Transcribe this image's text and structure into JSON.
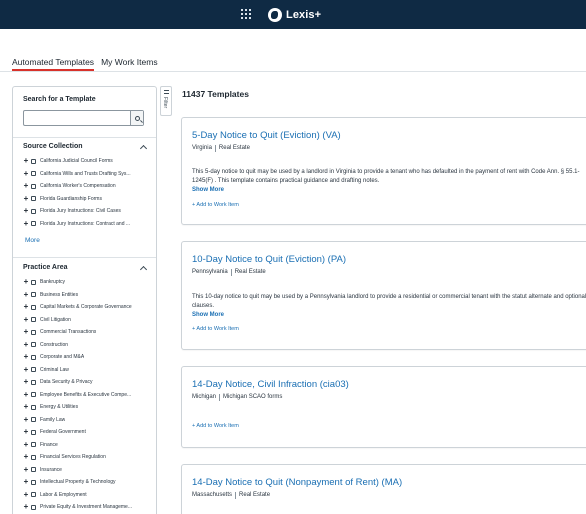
{
  "header": {
    "logo_text": "Lexis+"
  },
  "tabs": [
    {
      "label": "Automated Templates",
      "active": true
    },
    {
      "label": "My Work Items",
      "active": false
    }
  ],
  "search": {
    "title": "Search for a Template",
    "value": "",
    "placeholder": ""
  },
  "filter_label": "Filter",
  "source_collection": {
    "title": "Source Collection",
    "items": [
      "California Judicial Council Forms",
      "California Wills and Trusts Drafting Sys...",
      "California Worker's Compensation",
      "Florida Guardianship Forms",
      "Florida Jury Instructions: Civil Cases",
      "Florida Jury Instructions: Contract and ..."
    ],
    "more_label": "More"
  },
  "practice_area": {
    "title": "Practice Area",
    "items": [
      "Bankruptcy",
      "Business Entities",
      "Capital Markets & Corporate Governance",
      "Civil Litigation",
      "Commercial Transactions",
      "Construction",
      "Corporate and M&A",
      "Criminal Law",
      "Data Security & Privacy",
      "Employee Benefits & Executive Compe...",
      "Energy & Utilities",
      "Family Law",
      "Federal Government",
      "Finance",
      "Financial Services Regulation",
      "Insurance",
      "Intellectual Property & Technology",
      "Labor & Employment",
      "Private Equity & Investment Manageme..."
    ]
  },
  "results": {
    "count_label": "11437 Templates",
    "cards": [
      {
        "title": "5-Day Notice to Quit (Eviction) (VA)",
        "jurisdiction": "Virginia",
        "category": "Real Estate",
        "description": "This 5-day notice to quit may be used by a landlord in Virginia to provide a tenant who has defaulted in the payment of rent with Code Ann. § 55.1-1245(F) . This template contains practical guidance and drafting notes.",
        "show_more": "Show More",
        "add_label": "+ Add to Work Item"
      },
      {
        "title": "10-Day Notice to Quit (Eviction) (PA)",
        "jurisdiction": "Pennsylvania",
        "category": "Real Estate",
        "description": "This 10-day notice to quit may be used by a Pennsylvania landlord to provide a residential or commercial tenant with the statut alternate and optional clauses.",
        "show_more": "Show More",
        "add_label": "+ Add to Work Item"
      },
      {
        "title": "14-Day Notice, Civil Infraction (cia03)",
        "jurisdiction": "Michigan",
        "category": "Michigan SCAO forms",
        "add_label": "+ Add to Work Item"
      },
      {
        "title": "14-Day Notice to Quit (Nonpayment of Rent) (MA)",
        "jurisdiction": "Massachusetts",
        "category": "Real Estate"
      }
    ]
  },
  "colors": {
    "header_bg": "#0f2a44",
    "link": "#1a6fb3",
    "active_tab_underline": "#d8322b"
  },
  "icons": [
    "apps-grid-icon",
    "lexis-logo-icon",
    "search-icon",
    "filter-icon",
    "chevron-up-icon",
    "plus-icon"
  ]
}
